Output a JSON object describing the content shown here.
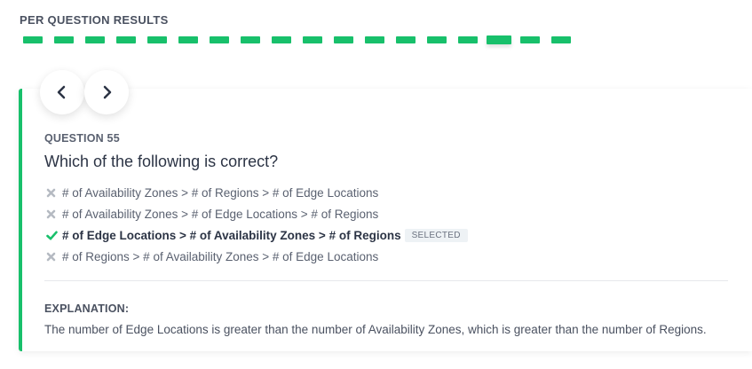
{
  "results": {
    "title": "PER QUESTION RESULTS",
    "question_count": 18,
    "current_index": 15,
    "color_correct": "#18c06b"
  },
  "nav": {
    "prev_icon": "chevron-left-icon",
    "next_icon": "chevron-right-icon"
  },
  "question": {
    "label": "QUESTION 55",
    "text": "Which of the following is correct?",
    "answers": [
      {
        "text": "# of Availability Zones > # of Regions > # of Edge Locations",
        "status": "incorrect",
        "icon": "x-icon"
      },
      {
        "text": "# of Availability Zones > # of Edge Locations > # of Regions",
        "status": "incorrect",
        "icon": "x-icon"
      },
      {
        "text": "# of Edge Locations > # of Availability Zones > # of Regions",
        "status": "correct",
        "icon": "check-icon",
        "badge": "SELECTED"
      },
      {
        "text": "# of Regions > # of Availability Zones > # of Edge Locations",
        "status": "incorrect",
        "icon": "x-icon"
      }
    ]
  },
  "explanation": {
    "label": "EXPLANATION:",
    "text": "The number of Edge Locations is greater than the number of Availability Zones, which is greater than the number of Regions."
  }
}
